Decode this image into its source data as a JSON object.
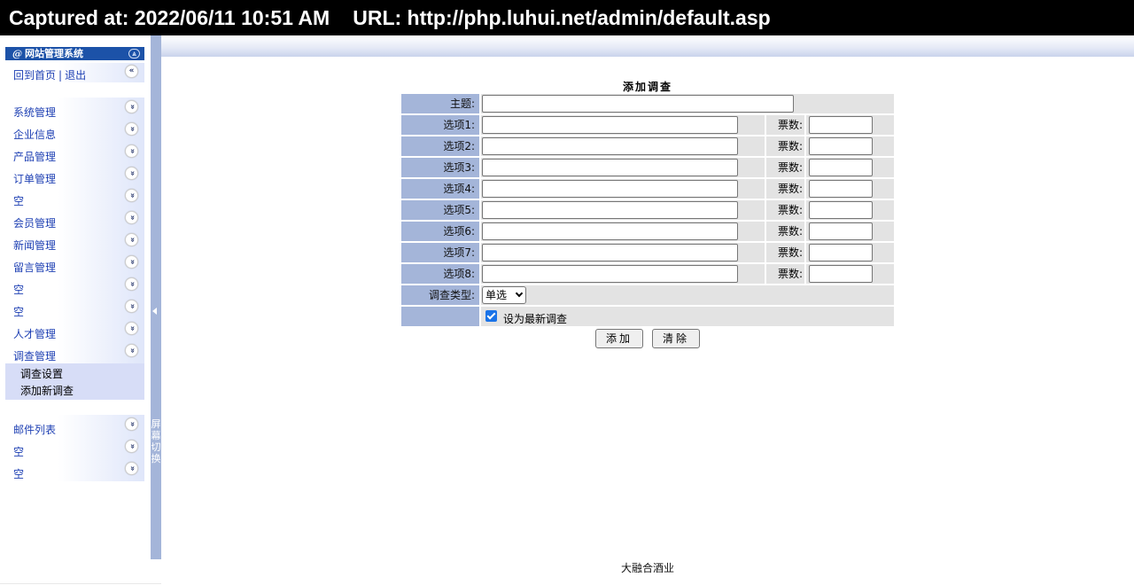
{
  "capture": {
    "label": "Captured at: 2022/06/11 10:51 AM",
    "url": "URL: http://php.luhui.net/admin/default.asp"
  },
  "sidebar": {
    "header": {
      "at": "@",
      "title": "网站管理系统",
      "chevron": "⩓"
    },
    "home": {
      "home_label": "回到首页",
      "separator": "|",
      "logout_label": "退出",
      "collapse_chevron": "«"
    },
    "group1": [
      "系统管理",
      "企业信息",
      "产品管理",
      "订单管理",
      "空",
      "会员管理",
      "新闻管理",
      "留言管理",
      "空",
      "空",
      "人才管理",
      "调查管理"
    ],
    "submenu": [
      "调查设置",
      "添加新调查"
    ],
    "group2": [
      "邮件列表",
      "空",
      "空"
    ],
    "chevron_glyph": "»"
  },
  "splitter": {
    "label": "屏幕切换"
  },
  "form": {
    "title": "添加调查",
    "subject_label": "主题:",
    "options": [
      {
        "label": "选项1:",
        "votes_label": "票数:"
      },
      {
        "label": "选项2:",
        "votes_label": "票数:"
      },
      {
        "label": "选项3:",
        "votes_label": "票数:"
      },
      {
        "label": "选项4:",
        "votes_label": "票数:"
      },
      {
        "label": "选项5:",
        "votes_label": "票数:"
      },
      {
        "label": "选项6:",
        "votes_label": "票数:"
      },
      {
        "label": "选项7:",
        "votes_label": "票数:"
      },
      {
        "label": "选项8:",
        "votes_label": "票数:"
      }
    ],
    "type_label": "调查类型:",
    "type_value": "单选",
    "latest_label": "设为最新调查",
    "latest_checked": true,
    "add_button": "添加",
    "clear_button": "清除"
  },
  "footer": {
    "text": "大融合酒业"
  },
  "colors": {
    "label_bg": "#a4b5d9",
    "cell_bg": "#e3e3e3",
    "link": "#1d3fb3",
    "header_bg": "#1c52a8"
  }
}
